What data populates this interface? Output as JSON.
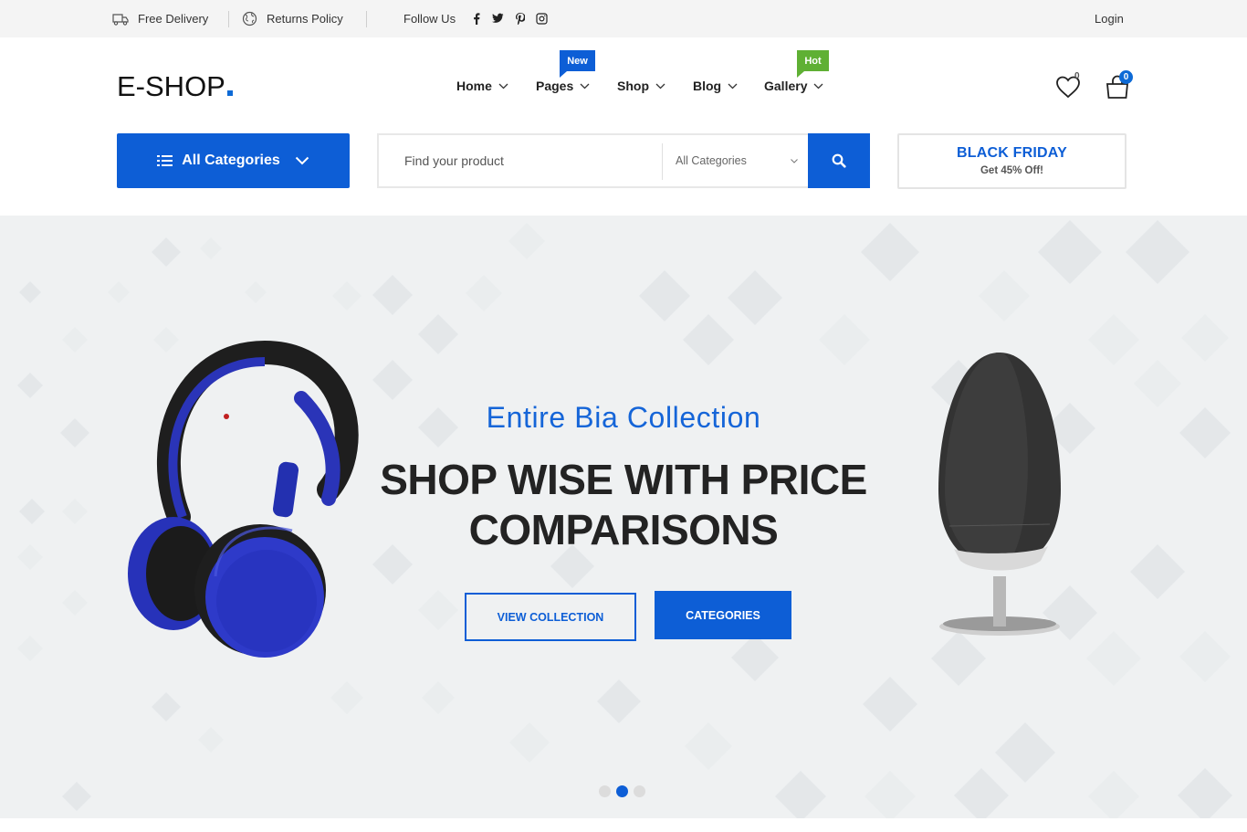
{
  "topbar": {
    "free_delivery": "Free Delivery",
    "returns_policy": "Returns Policy",
    "follow_us": "Follow Us",
    "social_icons": [
      "facebook-icon",
      "twitter-icon",
      "pinterest-icon",
      "instagram-icon"
    ],
    "login": "Login"
  },
  "header": {
    "logo": "E-SHOP",
    "nav": [
      {
        "label": "Home"
      },
      {
        "label": "Pages",
        "badge": "New"
      },
      {
        "label": "Shop"
      },
      {
        "label": "Blog"
      },
      {
        "label": "Gallery",
        "badge": "Hot"
      }
    ],
    "wishlist_count": "0",
    "cart_count": "0"
  },
  "search": {
    "all_categories_button": "All Categories",
    "placeholder": "Find your product",
    "category_select": "All Categories"
  },
  "promo": {
    "title": "BLACK FRIDAY",
    "subtitle": "Get 45% Off!"
  },
  "hero": {
    "subtitle": "Entire Bia Collection",
    "title": "SHOP WISE WITH PRICE COMPARISONS",
    "primary_button": "VIEW COLLECTION",
    "secondary_button": "CATEGORIES",
    "slides": 3,
    "active_slide": 2
  },
  "colors": {
    "accent": "#0d5ed6",
    "hot_badge": "#5fb034",
    "hero_bg": "#eff1f2"
  }
}
